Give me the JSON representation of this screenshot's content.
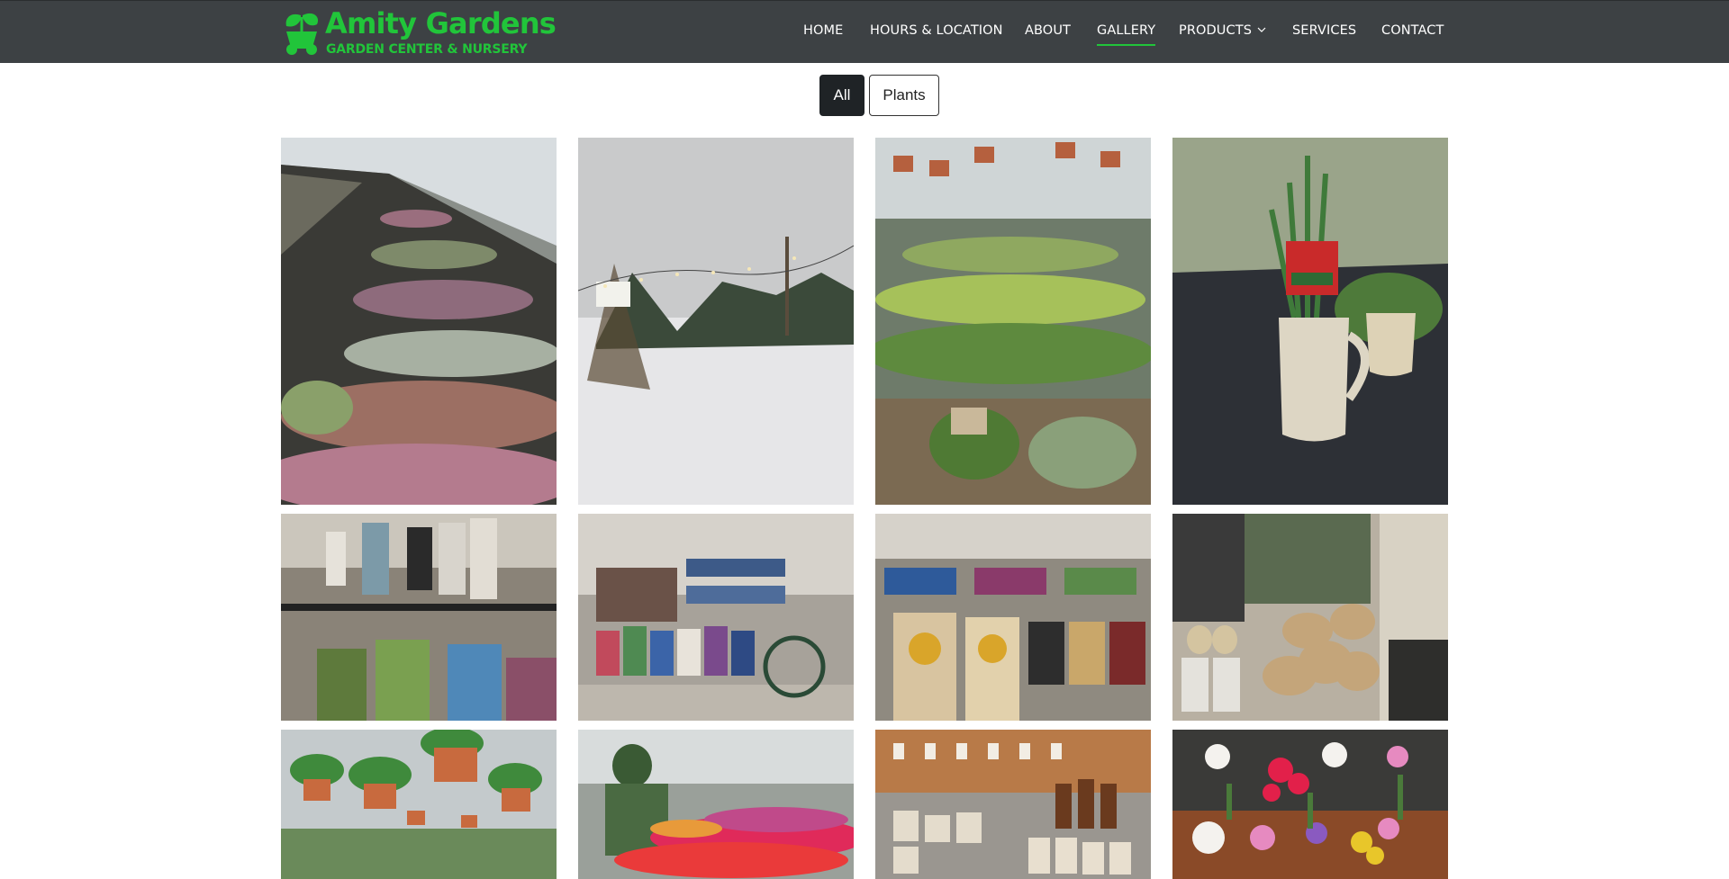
{
  "brand": {
    "name": "Amity Gardens",
    "tagline": "GARDEN CENTER & NURSERY",
    "color": "#21c53a"
  },
  "nav": {
    "items": [
      {
        "label": "HOME"
      },
      {
        "label": "HOURS & LOCATION"
      },
      {
        "label": "ABOUT"
      },
      {
        "label": "GALLERY",
        "active": true
      },
      {
        "label": "PRODUCTS",
        "has_dropdown": true,
        "icon": "chevron-down-icon"
      },
      {
        "label": "SERVICES"
      },
      {
        "label": "CONTACT"
      }
    ]
  },
  "filters": {
    "items": [
      {
        "label": "All",
        "selected": true
      },
      {
        "label": "Plants",
        "selected": false
      }
    ]
  },
  "gallery": {
    "photos": [
      {
        "subject": "greenhouse-succulents"
      },
      {
        "subject": "snowy-christmas-tree-lot"
      },
      {
        "subject": "greenhouse-houseplants"
      },
      {
        "subject": "rosemary-in-mug"
      },
      {
        "subject": "bird-feeders-and-seed"
      },
      {
        "subject": "bird-seed-display"
      },
      {
        "subject": "sunflower-bird-seed-bags"
      },
      {
        "subject": "firewood-and-supplies"
      },
      {
        "subject": "hanging-baskets"
      },
      {
        "subject": "flowering-greenhouse"
      },
      {
        "subject": "candles-and-soaps"
      },
      {
        "subject": "fresh-flower-arrangements"
      }
    ]
  },
  "colors": {
    "header_bg": "#3d4144",
    "active_filter_bg": "#1f2326"
  }
}
